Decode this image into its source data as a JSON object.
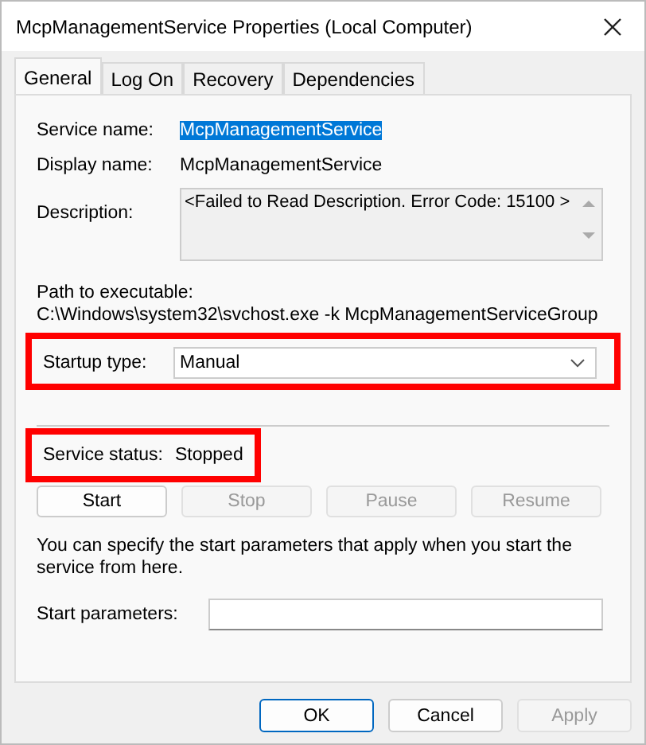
{
  "window": {
    "title": "McpManagementService Properties (Local Computer)"
  },
  "tabs": [
    {
      "label": "General",
      "selected": true
    },
    {
      "label": "Log On",
      "selected": false
    },
    {
      "label": "Recovery",
      "selected": false
    },
    {
      "label": "Dependencies",
      "selected": false
    }
  ],
  "service_name": {
    "label": "Service name:",
    "value": "McpManagementService",
    "selected": true
  },
  "display_name": {
    "label": "Display name:",
    "value": "McpManagementService"
  },
  "description": {
    "label": "Description:",
    "value": "<Failed to Read Description. Error Code: 15100 >"
  },
  "path": {
    "label": "Path to executable:",
    "value": "C:\\Windows\\system32\\svchost.exe -k McpManagementServiceGroup"
  },
  "startup_type": {
    "label": "Startup type:",
    "value": "Manual",
    "highlighted": true
  },
  "service_status": {
    "label": "Service status:",
    "value": "Stopped",
    "highlighted": true
  },
  "service_buttons": [
    {
      "label": "Start",
      "disabled": false
    },
    {
      "label": "Stop",
      "disabled": true
    },
    {
      "label": "Pause",
      "disabled": true
    },
    {
      "label": "Resume",
      "disabled": true
    }
  ],
  "hint": "You can specify the start parameters that apply when you start the service from here.",
  "start_parameters": {
    "label": "Start parameters:"
  },
  "buttons": [
    {
      "label": "OK",
      "disabled": false,
      "default": true
    },
    {
      "label": "Cancel",
      "disabled": false,
      "default": false
    },
    {
      "label": "Apply",
      "disabled": true,
      "default": false
    }
  ]
}
